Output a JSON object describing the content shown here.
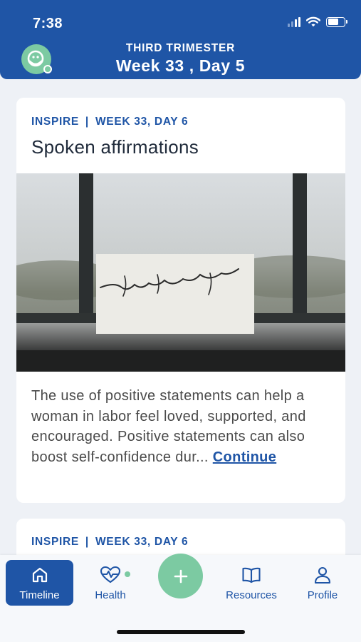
{
  "status_bar": {
    "time": "7:38"
  },
  "header": {
    "trimester": "THIRD TRIMESTER",
    "week": "Week 33 , Day 5"
  },
  "cards": [
    {
      "category": "INSPIRE",
      "separator": "|",
      "day": "WEEK 33, DAY 6",
      "title": "Spoken affirmations",
      "image_text": "mindfulness",
      "body": "The use of positive statements can help a woman in labor feel loved, supported, and encouraged. Positive statements can also boost self-confidence dur...",
      "link": "Continue"
    },
    {
      "category": "INSPIRE",
      "separator": "|",
      "day": "WEEK 33, DAY 6"
    }
  ],
  "tabbar": {
    "timeline": "Timeline",
    "health": "Health",
    "resources": "Resources",
    "profile": "Profile"
  },
  "colors": {
    "brand_blue": "#1f55a6",
    "accent_green": "#7ccaa2",
    "background": "#eef1f6"
  },
  "icons": [
    "signal-icon",
    "wifi-icon",
    "battery-icon",
    "app-logo-icon",
    "home-icon",
    "heart-pulse-icon",
    "plus-icon",
    "book-icon",
    "person-icon"
  ]
}
